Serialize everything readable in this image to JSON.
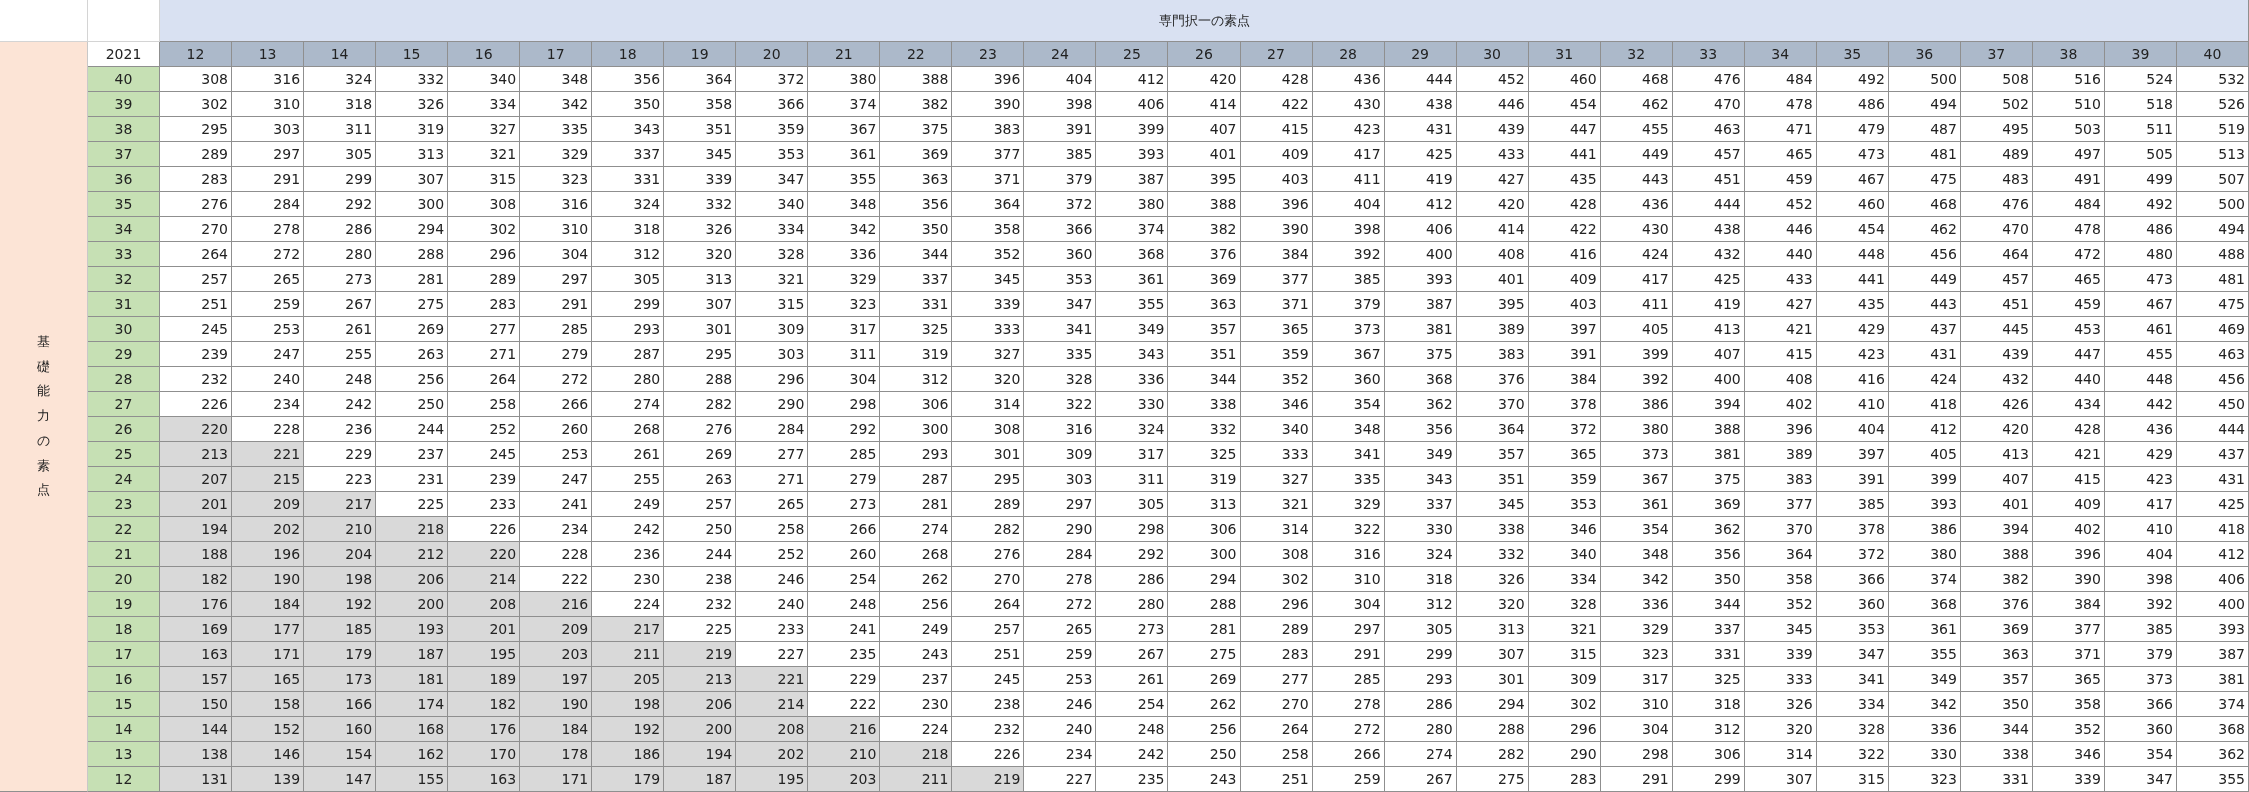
{
  "sheet": {
    "column_group_title": "専門択一の素点",
    "row_group_title": "基礎能力の素点",
    "corner_label": "2021",
    "columns": [
      "12",
      "13",
      "14",
      "15",
      "16",
      "17",
      "18",
      "19",
      "20",
      "21",
      "22",
      "23",
      "24",
      "25",
      "26",
      "27",
      "28",
      "29",
      "30",
      "31",
      "32",
      "33",
      "34",
      "35",
      "36",
      "37",
      "38",
      "39",
      "40"
    ],
    "rows": [
      {
        "label": "40",
        "cells": [
          "308",
          "316",
          "324",
          "332",
          "340",
          "348",
          "356",
          "364",
          "372",
          "380",
          "388",
          "396",
          "404",
          "412",
          "420",
          "428",
          "436",
          "444",
          "452",
          "460",
          "468",
          "476",
          "484",
          "492",
          "500",
          "508",
          "516",
          "524",
          "532"
        ],
        "shaded": [
          false,
          false,
          false,
          false,
          false,
          false,
          false,
          false,
          false,
          false,
          false,
          false,
          false,
          false,
          false,
          false,
          false,
          false,
          false,
          false,
          false,
          false,
          false,
          false,
          false,
          false,
          false,
          false,
          false
        ]
      },
      {
        "label": "39",
        "cells": [
          "302",
          "310",
          "318",
          "326",
          "334",
          "342",
          "350",
          "358",
          "366",
          "374",
          "382",
          "390",
          "398",
          "406",
          "414",
          "422",
          "430",
          "438",
          "446",
          "454",
          "462",
          "470",
          "478",
          "486",
          "494",
          "502",
          "510",
          "518",
          "526"
        ],
        "shaded": [
          false,
          false,
          false,
          false,
          false,
          false,
          false,
          false,
          false,
          false,
          false,
          false,
          false,
          false,
          false,
          false,
          false,
          false,
          false,
          false,
          false,
          false,
          false,
          false,
          false,
          false,
          false,
          false,
          false
        ]
      },
      {
        "label": "38",
        "cells": [
          "295",
          "303",
          "311",
          "319",
          "327",
          "335",
          "343",
          "351",
          "359",
          "367",
          "375",
          "383",
          "391",
          "399",
          "407",
          "415",
          "423",
          "431",
          "439",
          "447",
          "455",
          "463",
          "471",
          "479",
          "487",
          "495",
          "503",
          "511",
          "519"
        ],
        "shaded": [
          false,
          false,
          false,
          false,
          false,
          false,
          false,
          false,
          false,
          false,
          false,
          false,
          false,
          false,
          false,
          false,
          false,
          false,
          false,
          false,
          false,
          false,
          false,
          false,
          false,
          false,
          false,
          false,
          false
        ]
      },
      {
        "label": "37",
        "cells": [
          "289",
          "297",
          "305",
          "313",
          "321",
          "329",
          "337",
          "345",
          "353",
          "361",
          "369",
          "377",
          "385",
          "393",
          "401",
          "409",
          "417",
          "425",
          "433",
          "441",
          "449",
          "457",
          "465",
          "473",
          "481",
          "489",
          "497",
          "505",
          "513"
        ],
        "shaded": [
          false,
          false,
          false,
          false,
          false,
          false,
          false,
          false,
          false,
          false,
          false,
          false,
          false,
          false,
          false,
          false,
          false,
          false,
          false,
          false,
          false,
          false,
          false,
          false,
          false,
          false,
          false,
          false,
          false
        ]
      },
      {
        "label": "36",
        "cells": [
          "283",
          "291",
          "299",
          "307",
          "315",
          "323",
          "331",
          "339",
          "347",
          "355",
          "363",
          "371",
          "379",
          "387",
          "395",
          "403",
          "411",
          "419",
          "427",
          "435",
          "443",
          "451",
          "459",
          "467",
          "475",
          "483",
          "491",
          "499",
          "507"
        ],
        "shaded": [
          false,
          false,
          false,
          false,
          false,
          false,
          false,
          false,
          false,
          false,
          false,
          false,
          false,
          false,
          false,
          false,
          false,
          false,
          false,
          false,
          false,
          false,
          false,
          false,
          false,
          false,
          false,
          false,
          false
        ]
      },
      {
        "label": "35",
        "cells": [
          "276",
          "284",
          "292",
          "300",
          "308",
          "316",
          "324",
          "332",
          "340",
          "348",
          "356",
          "364",
          "372",
          "380",
          "388",
          "396",
          "404",
          "412",
          "420",
          "428",
          "436",
          "444",
          "452",
          "460",
          "468",
          "476",
          "484",
          "492",
          "500"
        ],
        "shaded": [
          false,
          false,
          false,
          false,
          false,
          false,
          false,
          false,
          false,
          false,
          false,
          false,
          false,
          false,
          false,
          false,
          false,
          false,
          false,
          false,
          false,
          false,
          false,
          false,
          false,
          false,
          false,
          false,
          false
        ]
      },
      {
        "label": "34",
        "cells": [
          "270",
          "278",
          "286",
          "294",
          "302",
          "310",
          "318",
          "326",
          "334",
          "342",
          "350",
          "358",
          "366",
          "374",
          "382",
          "390",
          "398",
          "406",
          "414",
          "422",
          "430",
          "438",
          "446",
          "454",
          "462",
          "470",
          "478",
          "486",
          "494"
        ],
        "shaded": [
          false,
          false,
          false,
          false,
          false,
          false,
          false,
          false,
          false,
          false,
          false,
          false,
          false,
          false,
          false,
          false,
          false,
          false,
          false,
          false,
          false,
          false,
          false,
          false,
          false,
          false,
          false,
          false,
          false
        ]
      },
      {
        "label": "33",
        "cells": [
          "264",
          "272",
          "280",
          "288",
          "296",
          "304",
          "312",
          "320",
          "328",
          "336",
          "344",
          "352",
          "360",
          "368",
          "376",
          "384",
          "392",
          "400",
          "408",
          "416",
          "424",
          "432",
          "440",
          "448",
          "456",
          "464",
          "472",
          "480",
          "488"
        ],
        "shaded": [
          false,
          false,
          false,
          false,
          false,
          false,
          false,
          false,
          false,
          false,
          false,
          false,
          false,
          false,
          false,
          false,
          false,
          false,
          false,
          false,
          false,
          false,
          false,
          false,
          false,
          false,
          false,
          false,
          false
        ]
      },
      {
        "label": "32",
        "cells": [
          "257",
          "265",
          "273",
          "281",
          "289",
          "297",
          "305",
          "313",
          "321",
          "329",
          "337",
          "345",
          "353",
          "361",
          "369",
          "377",
          "385",
          "393",
          "401",
          "409",
          "417",
          "425",
          "433",
          "441",
          "449",
          "457",
          "465",
          "473",
          "481"
        ],
        "shaded": [
          false,
          false,
          false,
          false,
          false,
          false,
          false,
          false,
          false,
          false,
          false,
          false,
          false,
          false,
          false,
          false,
          false,
          false,
          false,
          false,
          false,
          false,
          false,
          false,
          false,
          false,
          false,
          false,
          false
        ]
      },
      {
        "label": "31",
        "cells": [
          "251",
          "259",
          "267",
          "275",
          "283",
          "291",
          "299",
          "307",
          "315",
          "323",
          "331",
          "339",
          "347",
          "355",
          "363",
          "371",
          "379",
          "387",
          "395",
          "403",
          "411",
          "419",
          "427",
          "435",
          "443",
          "451",
          "459",
          "467",
          "475"
        ],
        "shaded": [
          false,
          false,
          false,
          false,
          false,
          false,
          false,
          false,
          false,
          false,
          false,
          false,
          false,
          false,
          false,
          false,
          false,
          false,
          false,
          false,
          false,
          false,
          false,
          false,
          false,
          false,
          false,
          false,
          false
        ]
      },
      {
        "label": "30",
        "cells": [
          "245",
          "253",
          "261",
          "269",
          "277",
          "285",
          "293",
          "301",
          "309",
          "317",
          "325",
          "333",
          "341",
          "349",
          "357",
          "365",
          "373",
          "381",
          "389",
          "397",
          "405",
          "413",
          "421",
          "429",
          "437",
          "445",
          "453",
          "461",
          "469"
        ],
        "shaded": [
          false,
          false,
          false,
          false,
          false,
          false,
          false,
          false,
          false,
          false,
          false,
          false,
          false,
          false,
          false,
          false,
          false,
          false,
          false,
          false,
          false,
          false,
          false,
          false,
          false,
          false,
          false,
          false,
          false
        ]
      },
      {
        "label": "29",
        "cells": [
          "239",
          "247",
          "255",
          "263",
          "271",
          "279",
          "287",
          "295",
          "303",
          "311",
          "319",
          "327",
          "335",
          "343",
          "351",
          "359",
          "367",
          "375",
          "383",
          "391",
          "399",
          "407",
          "415",
          "423",
          "431",
          "439",
          "447",
          "455",
          "463"
        ],
        "shaded": [
          false,
          false,
          false,
          false,
          false,
          false,
          false,
          false,
          false,
          false,
          false,
          false,
          false,
          false,
          false,
          false,
          false,
          false,
          false,
          false,
          false,
          false,
          false,
          false,
          false,
          false,
          false,
          false,
          false
        ]
      },
      {
        "label": "28",
        "cells": [
          "232",
          "240",
          "248",
          "256",
          "264",
          "272",
          "280",
          "288",
          "296",
          "304",
          "312",
          "320",
          "328",
          "336",
          "344",
          "352",
          "360",
          "368",
          "376",
          "384",
          "392",
          "400",
          "408",
          "416",
          "424",
          "432",
          "440",
          "448",
          "456"
        ],
        "shaded": [
          false,
          false,
          false,
          false,
          false,
          false,
          false,
          false,
          false,
          false,
          false,
          false,
          false,
          false,
          false,
          false,
          false,
          false,
          false,
          false,
          false,
          false,
          false,
          false,
          false,
          false,
          false,
          false,
          false
        ]
      },
      {
        "label": "27",
        "cells": [
          "226",
          "234",
          "242",
          "250",
          "258",
          "266",
          "274",
          "282",
          "290",
          "298",
          "306",
          "314",
          "322",
          "330",
          "338",
          "346",
          "354",
          "362",
          "370",
          "378",
          "386",
          "394",
          "402",
          "410",
          "418",
          "426",
          "434",
          "442",
          "450"
        ],
        "shaded": [
          false,
          false,
          false,
          false,
          false,
          false,
          false,
          false,
          false,
          false,
          false,
          false,
          false,
          false,
          false,
          false,
          false,
          false,
          false,
          false,
          false,
          false,
          false,
          false,
          false,
          false,
          false,
          false,
          false
        ]
      },
      {
        "label": "26",
        "cells": [
          "220",
          "228",
          "236",
          "244",
          "252",
          "260",
          "268",
          "276",
          "284",
          "292",
          "300",
          "308",
          "316",
          "324",
          "332",
          "340",
          "348",
          "356",
          "364",
          "372",
          "380",
          "388",
          "396",
          "404",
          "412",
          "420",
          "428",
          "436",
          "444"
        ],
        "shaded": [
          true,
          false,
          false,
          false,
          false,
          false,
          false,
          false,
          false,
          false,
          false,
          false,
          false,
          false,
          false,
          false,
          false,
          false,
          false,
          false,
          false,
          false,
          false,
          false,
          false,
          false,
          false,
          false,
          false
        ]
      },
      {
        "label": "25",
        "cells": [
          "213",
          "221",
          "229",
          "237",
          "245",
          "253",
          "261",
          "269",
          "277",
          "285",
          "293",
          "301",
          "309",
          "317",
          "325",
          "333",
          "341",
          "349",
          "357",
          "365",
          "373",
          "381",
          "389",
          "397",
          "405",
          "413",
          "421",
          "429",
          "437"
        ],
        "shaded": [
          true,
          true,
          false,
          false,
          false,
          false,
          false,
          false,
          false,
          false,
          false,
          false,
          false,
          false,
          false,
          false,
          false,
          false,
          false,
          false,
          false,
          false,
          false,
          false,
          false,
          false,
          false,
          false,
          false
        ]
      },
      {
        "label": "24",
        "cells": [
          "207",
          "215",
          "223",
          "231",
          "239",
          "247",
          "255",
          "263",
          "271",
          "279",
          "287",
          "295",
          "303",
          "311",
          "319",
          "327",
          "335",
          "343",
          "351",
          "359",
          "367",
          "375",
          "383",
          "391",
          "399",
          "407",
          "415",
          "423",
          "431"
        ],
        "shaded": [
          true,
          true,
          false,
          false,
          false,
          false,
          false,
          false,
          false,
          false,
          false,
          false,
          false,
          false,
          false,
          false,
          false,
          false,
          false,
          false,
          false,
          false,
          false,
          false,
          false,
          false,
          false,
          false,
          false
        ]
      },
      {
        "label": "23",
        "cells": [
          "201",
          "209",
          "217",
          "225",
          "233",
          "241",
          "249",
          "257",
          "265",
          "273",
          "281",
          "289",
          "297",
          "305",
          "313",
          "321",
          "329",
          "337",
          "345",
          "353",
          "361",
          "369",
          "377",
          "385",
          "393",
          "401",
          "409",
          "417",
          "425"
        ],
        "shaded": [
          true,
          true,
          true,
          false,
          false,
          false,
          false,
          false,
          false,
          false,
          false,
          false,
          false,
          false,
          false,
          false,
          false,
          false,
          false,
          false,
          false,
          false,
          false,
          false,
          false,
          false,
          false,
          false,
          false
        ]
      },
      {
        "label": "22",
        "cells": [
          "194",
          "202",
          "210",
          "218",
          "226",
          "234",
          "242",
          "250",
          "258",
          "266",
          "274",
          "282",
          "290",
          "298",
          "306",
          "314",
          "322",
          "330",
          "338",
          "346",
          "354",
          "362",
          "370",
          "378",
          "386",
          "394",
          "402",
          "410",
          "418"
        ],
        "shaded": [
          true,
          true,
          true,
          true,
          false,
          false,
          false,
          false,
          false,
          false,
          false,
          false,
          false,
          false,
          false,
          false,
          false,
          false,
          false,
          false,
          false,
          false,
          false,
          false,
          false,
          false,
          false,
          false,
          false
        ]
      },
      {
        "label": "21",
        "cells": [
          "188",
          "196",
          "204",
          "212",
          "220",
          "228",
          "236",
          "244",
          "252",
          "260",
          "268",
          "276",
          "284",
          "292",
          "300",
          "308",
          "316",
          "324",
          "332",
          "340",
          "348",
          "356",
          "364",
          "372",
          "380",
          "388",
          "396",
          "404",
          "412"
        ],
        "shaded": [
          true,
          true,
          true,
          true,
          true,
          false,
          false,
          false,
          false,
          false,
          false,
          false,
          false,
          false,
          false,
          false,
          false,
          false,
          false,
          false,
          false,
          false,
          false,
          false,
          false,
          false,
          false,
          false,
          false
        ]
      },
      {
        "label": "20",
        "cells": [
          "182",
          "190",
          "198",
          "206",
          "214",
          "222",
          "230",
          "238",
          "246",
          "254",
          "262",
          "270",
          "278",
          "286",
          "294",
          "302",
          "310",
          "318",
          "326",
          "334",
          "342",
          "350",
          "358",
          "366",
          "374",
          "382",
          "390",
          "398",
          "406"
        ],
        "shaded": [
          true,
          true,
          true,
          true,
          true,
          false,
          false,
          false,
          false,
          false,
          false,
          false,
          false,
          false,
          false,
          false,
          false,
          false,
          false,
          false,
          false,
          false,
          false,
          false,
          false,
          false,
          false,
          false,
          false
        ]
      },
      {
        "label": "19",
        "cells": [
          "176",
          "184",
          "192",
          "200",
          "208",
          "216",
          "224",
          "232",
          "240",
          "248",
          "256",
          "264",
          "272",
          "280",
          "288",
          "296",
          "304",
          "312",
          "320",
          "328",
          "336",
          "344",
          "352",
          "360",
          "368",
          "376",
          "384",
          "392",
          "400"
        ],
        "shaded": [
          true,
          true,
          true,
          true,
          true,
          true,
          false,
          false,
          false,
          false,
          false,
          false,
          false,
          false,
          false,
          false,
          false,
          false,
          false,
          false,
          false,
          false,
          false,
          false,
          false,
          false,
          false,
          false,
          false
        ]
      },
      {
        "label": "18",
        "cells": [
          "169",
          "177",
          "185",
          "193",
          "201",
          "209",
          "217",
          "225",
          "233",
          "241",
          "249",
          "257",
          "265",
          "273",
          "281",
          "289",
          "297",
          "305",
          "313",
          "321",
          "329",
          "337",
          "345",
          "353",
          "361",
          "369",
          "377",
          "385",
          "393"
        ],
        "shaded": [
          true,
          true,
          true,
          true,
          true,
          true,
          true,
          false,
          false,
          false,
          false,
          false,
          false,
          false,
          false,
          false,
          false,
          false,
          false,
          false,
          false,
          false,
          false,
          false,
          false,
          false,
          false,
          false,
          false
        ]
      },
      {
        "label": "17",
        "cells": [
          "163",
          "171",
          "179",
          "187",
          "195",
          "203",
          "211",
          "219",
          "227",
          "235",
          "243",
          "251",
          "259",
          "267",
          "275",
          "283",
          "291",
          "299",
          "307",
          "315",
          "323",
          "331",
          "339",
          "347",
          "355",
          "363",
          "371",
          "379",
          "387"
        ],
        "shaded": [
          true,
          true,
          true,
          true,
          true,
          true,
          true,
          true,
          false,
          false,
          false,
          false,
          false,
          false,
          false,
          false,
          false,
          false,
          false,
          false,
          false,
          false,
          false,
          false,
          false,
          false,
          false,
          false,
          false
        ]
      },
      {
        "label": "16",
        "cells": [
          "157",
          "165",
          "173",
          "181",
          "189",
          "197",
          "205",
          "213",
          "221",
          "229",
          "237",
          "245",
          "253",
          "261",
          "269",
          "277",
          "285",
          "293",
          "301",
          "309",
          "317",
          "325",
          "333",
          "341",
          "349",
          "357",
          "365",
          "373",
          "381"
        ],
        "shaded": [
          true,
          true,
          true,
          true,
          true,
          true,
          true,
          true,
          true,
          false,
          false,
          false,
          false,
          false,
          false,
          false,
          false,
          false,
          false,
          false,
          false,
          false,
          false,
          false,
          false,
          false,
          false,
          false,
          false
        ]
      },
      {
        "label": "15",
        "cells": [
          "150",
          "158",
          "166",
          "174",
          "182",
          "190",
          "198",
          "206",
          "214",
          "222",
          "230",
          "238",
          "246",
          "254",
          "262",
          "270",
          "278",
          "286",
          "294",
          "302",
          "310",
          "318",
          "326",
          "334",
          "342",
          "350",
          "358",
          "366",
          "374"
        ],
        "shaded": [
          true,
          true,
          true,
          true,
          true,
          true,
          true,
          true,
          true,
          false,
          false,
          false,
          false,
          false,
          false,
          false,
          false,
          false,
          false,
          false,
          false,
          false,
          false,
          false,
          false,
          false,
          false,
          false,
          false
        ]
      },
      {
        "label": "14",
        "cells": [
          "144",
          "152",
          "160",
          "168",
          "176",
          "184",
          "192",
          "200",
          "208",
          "216",
          "224",
          "232",
          "240",
          "248",
          "256",
          "264",
          "272",
          "280",
          "288",
          "296",
          "304",
          "312",
          "320",
          "328",
          "336",
          "344",
          "352",
          "360",
          "368"
        ],
        "shaded": [
          true,
          true,
          true,
          true,
          true,
          true,
          true,
          true,
          true,
          true,
          false,
          false,
          false,
          false,
          false,
          false,
          false,
          false,
          false,
          false,
          false,
          false,
          false,
          false,
          false,
          false,
          false,
          false,
          false
        ]
      },
      {
        "label": "13",
        "cells": [
          "138",
          "146",
          "154",
          "162",
          "170",
          "178",
          "186",
          "194",
          "202",
          "210",
          "218",
          "226",
          "234",
          "242",
          "250",
          "258",
          "266",
          "274",
          "282",
          "290",
          "298",
          "306",
          "314",
          "322",
          "330",
          "338",
          "346",
          "354",
          "362"
        ],
        "shaded": [
          true,
          true,
          true,
          true,
          true,
          true,
          true,
          true,
          true,
          true,
          true,
          false,
          false,
          false,
          false,
          false,
          false,
          false,
          false,
          false,
          false,
          false,
          false,
          false,
          false,
          false,
          false,
          false,
          false
        ]
      },
      {
        "label": "12",
        "cells": [
          "131",
          "139",
          "147",
          "155",
          "163",
          "171",
          "179",
          "187",
          "195",
          "203",
          "211",
          "219",
          "227",
          "235",
          "243",
          "251",
          "259",
          "267",
          "275",
          "283",
          "291",
          "299",
          "307",
          "315",
          "323",
          "331",
          "339",
          "347",
          "355"
        ],
        "shaded": [
          true,
          true,
          true,
          true,
          true,
          true,
          true,
          true,
          true,
          true,
          true,
          true,
          false,
          false,
          false,
          false,
          false,
          false,
          false,
          false,
          false,
          false,
          false,
          false,
          false,
          false,
          false,
          false,
          false
        ]
      }
    ]
  }
}
